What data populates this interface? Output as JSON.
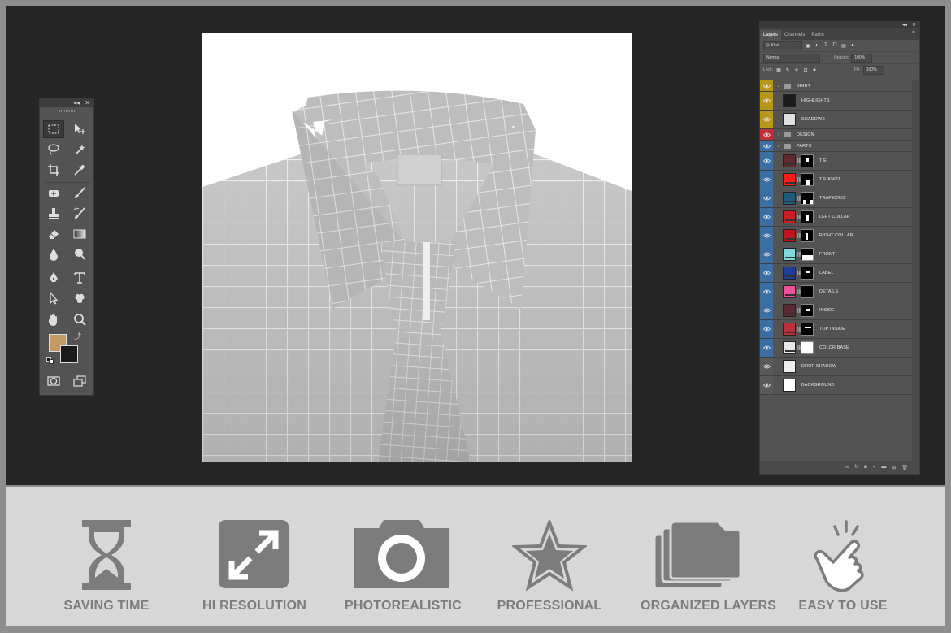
{
  "layers_panel": {
    "tabs": [
      "Layers",
      "Channels",
      "Paths"
    ],
    "filter_value": "Kind",
    "blend_mode": "Normal",
    "opacity_label": "Opacity:",
    "opacity_value": "100%",
    "lock_label": "Lock:",
    "fill_label": "Fill:",
    "fill_value": "100%",
    "layers": [
      {
        "name": "SHIRT",
        "type": "group",
        "expanded": true,
        "eye_color": "#b8961a"
      },
      {
        "name": "HIGHLIGHTS",
        "type": "layer",
        "eye_color": "#b8961a",
        "thumb_color": "#1a1a1a"
      },
      {
        "name": "SHADOWS",
        "type": "layer",
        "eye_color": "#b8961a",
        "thumb_color": "#e0e0e0"
      },
      {
        "name": "DESIGN",
        "type": "group",
        "expanded": false,
        "eye_color": "#c0303a"
      },
      {
        "name": "PARTS",
        "type": "group",
        "expanded": true,
        "eye_color": "#3d6ea3"
      },
      {
        "name": "TIE",
        "type": "layer",
        "eye_color": "#3d6ea3",
        "thumb_color": "#5e2a30"
      },
      {
        "name": "TIE KNOT",
        "type": "layer",
        "eye_color": "#3d6ea3",
        "thumb_color": "#ff1a1a"
      },
      {
        "name": "TRAPEZIUS",
        "type": "layer",
        "eye_color": "#3d6ea3",
        "thumb_color": "#1e5c7c"
      },
      {
        "name": "LEFT COLLAR",
        "type": "layer",
        "eye_color": "#3d6ea3",
        "thumb_color": "#cc1c24"
      },
      {
        "name": "RIGHT COLLAR",
        "type": "layer",
        "eye_color": "#3d6ea3",
        "thumb_color": "#c0141e"
      },
      {
        "name": "FRONT",
        "type": "layer",
        "eye_color": "#3d6ea3",
        "thumb_color": "#7fd8dc"
      },
      {
        "name": "LABEL",
        "type": "layer",
        "eye_color": "#3d6ea3",
        "thumb_color": "#1e3c9c"
      },
      {
        "name": "DETAILS",
        "type": "layer",
        "eye_color": "#3d6ea3",
        "thumb_color": "#f0509c"
      },
      {
        "name": "INSIDE",
        "type": "layer",
        "eye_color": "#3d6ea3",
        "thumb_color": "#5a2a32"
      },
      {
        "name": "TOP INSIDE",
        "type": "layer",
        "eye_color": "#3d6ea3",
        "thumb_color": "#b8303a"
      },
      {
        "name": "COLOR BASE",
        "type": "layer",
        "eye_color": "#3d6ea3",
        "thumb_color": "#e8e8e8"
      },
      {
        "name": "DROP SHADOW",
        "type": "layer",
        "eye_color": "#5a5a5a",
        "thumb_color": "#eeeeee"
      },
      {
        "name": "BACKGROUND",
        "type": "layer",
        "eye_color": "#5a5a5a",
        "thumb_color": "#ffffff"
      }
    ]
  },
  "tools": {
    "foreground_color": "#c39a64",
    "background_color": "#1a1a1a"
  },
  "features": [
    {
      "label": "SAVING TIME",
      "icon": "hourglass-icon"
    },
    {
      "label": "HI RESOLUTION",
      "icon": "expand-arrows-icon"
    },
    {
      "label": "PHOTOREALISTIC",
      "icon": "camera-icon"
    },
    {
      "label": "PROFESSIONAL",
      "icon": "star-icon"
    },
    {
      "label": "ORGANIZED LAYERS",
      "icon": "folders-icon"
    },
    {
      "label": "EASY TO USE",
      "icon": "pointing-hand-icon"
    }
  ]
}
